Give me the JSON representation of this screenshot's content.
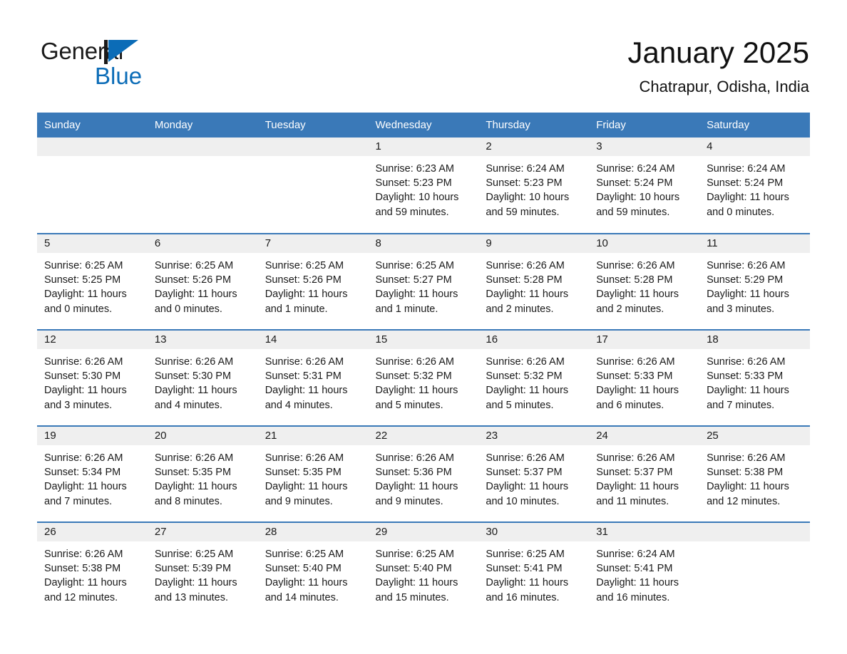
{
  "logo": {
    "word_one": "General",
    "word_two": "Blue",
    "flag_icon": "triangle-flag-icon"
  },
  "header": {
    "month_title": "January 2025",
    "location": "Chatrapur, Odisha, India"
  },
  "colors": {
    "header_blue": "#3a79b8",
    "logo_blue": "#0b6cb7",
    "daynum_band": "#efefef",
    "text": "#1a1a1a"
  },
  "calendar": {
    "weekday_headers": [
      "Sunday",
      "Monday",
      "Tuesday",
      "Wednesday",
      "Thursday",
      "Friday",
      "Saturday"
    ],
    "weeks": [
      [
        {
          "day": "",
          "sunrise": "",
          "sunset": "",
          "daylight": "",
          "empty": true
        },
        {
          "day": "",
          "sunrise": "",
          "sunset": "",
          "daylight": "",
          "empty": true
        },
        {
          "day": "",
          "sunrise": "",
          "sunset": "",
          "daylight": "",
          "empty": true
        },
        {
          "day": "1",
          "sunrise": "Sunrise: 6:23 AM",
          "sunset": "Sunset: 5:23 PM",
          "daylight": "Daylight: 10 hours and 59 minutes."
        },
        {
          "day": "2",
          "sunrise": "Sunrise: 6:24 AM",
          "sunset": "Sunset: 5:23 PM",
          "daylight": "Daylight: 10 hours and 59 minutes."
        },
        {
          "day": "3",
          "sunrise": "Sunrise: 6:24 AM",
          "sunset": "Sunset: 5:24 PM",
          "daylight": "Daylight: 10 hours and 59 minutes."
        },
        {
          "day": "4",
          "sunrise": "Sunrise: 6:24 AM",
          "sunset": "Sunset: 5:24 PM",
          "daylight": "Daylight: 11 hours and 0 minutes."
        }
      ],
      [
        {
          "day": "5",
          "sunrise": "Sunrise: 6:25 AM",
          "sunset": "Sunset: 5:25 PM",
          "daylight": "Daylight: 11 hours and 0 minutes."
        },
        {
          "day": "6",
          "sunrise": "Sunrise: 6:25 AM",
          "sunset": "Sunset: 5:26 PM",
          "daylight": "Daylight: 11 hours and 0 minutes."
        },
        {
          "day": "7",
          "sunrise": "Sunrise: 6:25 AM",
          "sunset": "Sunset: 5:26 PM",
          "daylight": "Daylight: 11 hours and 1 minute."
        },
        {
          "day": "8",
          "sunrise": "Sunrise: 6:25 AM",
          "sunset": "Sunset: 5:27 PM",
          "daylight": "Daylight: 11 hours and 1 minute."
        },
        {
          "day": "9",
          "sunrise": "Sunrise: 6:26 AM",
          "sunset": "Sunset: 5:28 PM",
          "daylight": "Daylight: 11 hours and 2 minutes."
        },
        {
          "day": "10",
          "sunrise": "Sunrise: 6:26 AM",
          "sunset": "Sunset: 5:28 PM",
          "daylight": "Daylight: 11 hours and 2 minutes."
        },
        {
          "day": "11",
          "sunrise": "Sunrise: 6:26 AM",
          "sunset": "Sunset: 5:29 PM",
          "daylight": "Daylight: 11 hours and 3 minutes."
        }
      ],
      [
        {
          "day": "12",
          "sunrise": "Sunrise: 6:26 AM",
          "sunset": "Sunset: 5:30 PM",
          "daylight": "Daylight: 11 hours and 3 minutes."
        },
        {
          "day": "13",
          "sunrise": "Sunrise: 6:26 AM",
          "sunset": "Sunset: 5:30 PM",
          "daylight": "Daylight: 11 hours and 4 minutes."
        },
        {
          "day": "14",
          "sunrise": "Sunrise: 6:26 AM",
          "sunset": "Sunset: 5:31 PM",
          "daylight": "Daylight: 11 hours and 4 minutes."
        },
        {
          "day": "15",
          "sunrise": "Sunrise: 6:26 AM",
          "sunset": "Sunset: 5:32 PM",
          "daylight": "Daylight: 11 hours and 5 minutes."
        },
        {
          "day": "16",
          "sunrise": "Sunrise: 6:26 AM",
          "sunset": "Sunset: 5:32 PM",
          "daylight": "Daylight: 11 hours and 5 minutes."
        },
        {
          "day": "17",
          "sunrise": "Sunrise: 6:26 AM",
          "sunset": "Sunset: 5:33 PM",
          "daylight": "Daylight: 11 hours and 6 minutes."
        },
        {
          "day": "18",
          "sunrise": "Sunrise: 6:26 AM",
          "sunset": "Sunset: 5:33 PM",
          "daylight": "Daylight: 11 hours and 7 minutes."
        }
      ],
      [
        {
          "day": "19",
          "sunrise": "Sunrise: 6:26 AM",
          "sunset": "Sunset: 5:34 PM",
          "daylight": "Daylight: 11 hours and 7 minutes."
        },
        {
          "day": "20",
          "sunrise": "Sunrise: 6:26 AM",
          "sunset": "Sunset: 5:35 PM",
          "daylight": "Daylight: 11 hours and 8 minutes."
        },
        {
          "day": "21",
          "sunrise": "Sunrise: 6:26 AM",
          "sunset": "Sunset: 5:35 PM",
          "daylight": "Daylight: 11 hours and 9 minutes."
        },
        {
          "day": "22",
          "sunrise": "Sunrise: 6:26 AM",
          "sunset": "Sunset: 5:36 PM",
          "daylight": "Daylight: 11 hours and 9 minutes."
        },
        {
          "day": "23",
          "sunrise": "Sunrise: 6:26 AM",
          "sunset": "Sunset: 5:37 PM",
          "daylight": "Daylight: 11 hours and 10 minutes."
        },
        {
          "day": "24",
          "sunrise": "Sunrise: 6:26 AM",
          "sunset": "Sunset: 5:37 PM",
          "daylight": "Daylight: 11 hours and 11 minutes."
        },
        {
          "day": "25",
          "sunrise": "Sunrise: 6:26 AM",
          "sunset": "Sunset: 5:38 PM",
          "daylight": "Daylight: 11 hours and 12 minutes."
        }
      ],
      [
        {
          "day": "26",
          "sunrise": "Sunrise: 6:26 AM",
          "sunset": "Sunset: 5:38 PM",
          "daylight": "Daylight: 11 hours and 12 minutes."
        },
        {
          "day": "27",
          "sunrise": "Sunrise: 6:25 AM",
          "sunset": "Sunset: 5:39 PM",
          "daylight": "Daylight: 11 hours and 13 minutes."
        },
        {
          "day": "28",
          "sunrise": "Sunrise: 6:25 AM",
          "sunset": "Sunset: 5:40 PM",
          "daylight": "Daylight: 11 hours and 14 minutes."
        },
        {
          "day": "29",
          "sunrise": "Sunrise: 6:25 AM",
          "sunset": "Sunset: 5:40 PM",
          "daylight": "Daylight: 11 hours and 15 minutes."
        },
        {
          "day": "30",
          "sunrise": "Sunrise: 6:25 AM",
          "sunset": "Sunset: 5:41 PM",
          "daylight": "Daylight: 11 hours and 16 minutes."
        },
        {
          "day": "31",
          "sunrise": "Sunrise: 6:24 AM",
          "sunset": "Sunset: 5:41 PM",
          "daylight": "Daylight: 11 hours and 16 minutes."
        },
        {
          "day": "",
          "sunrise": "",
          "sunset": "",
          "daylight": "",
          "empty": true
        }
      ]
    ]
  }
}
